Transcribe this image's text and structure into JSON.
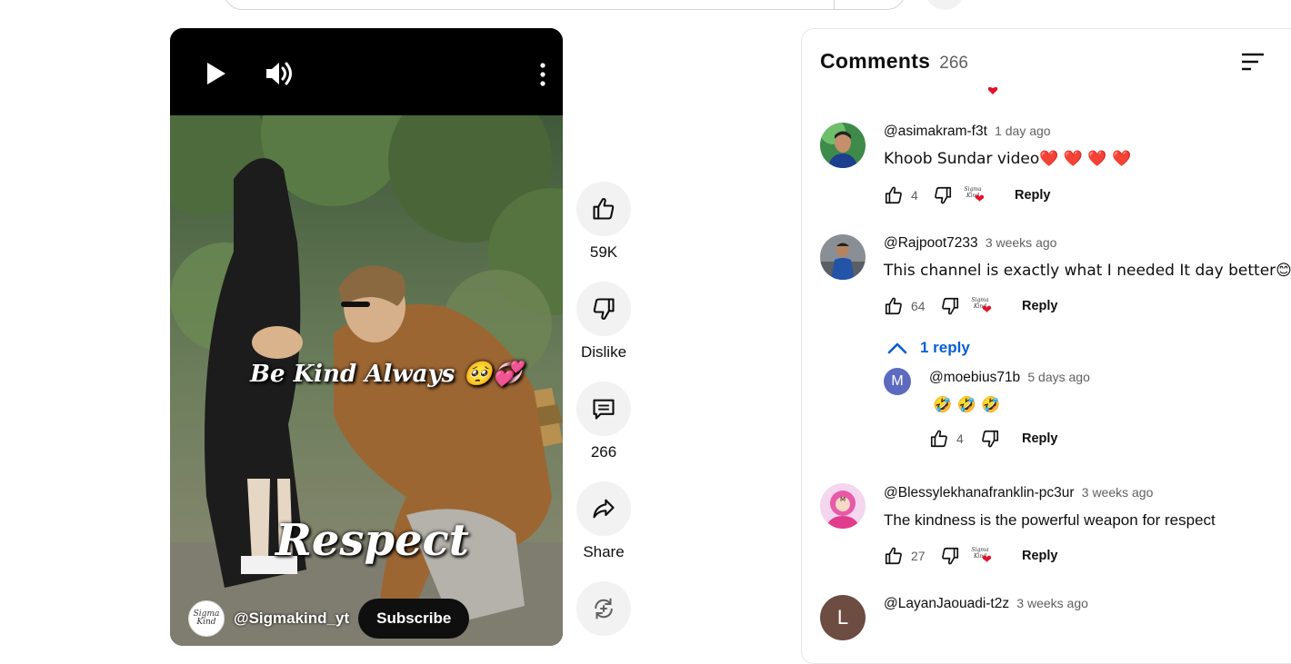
{
  "player": {
    "caption_top": "Be Kind Always 🥺💞",
    "caption_bottom": "Respect",
    "channel_handle": "@Sigmakind_yt",
    "channel_avatar_text": "Sigma Kind",
    "subscribe_label": "Subscribe",
    "icons": {
      "play": "play-icon",
      "volume": "volume-icon",
      "more": "more-vert-icon"
    }
  },
  "actions": {
    "like_count": "59K",
    "dislike_label": "Dislike",
    "comment_count": "266",
    "share_label": "Share"
  },
  "comments": {
    "title": "Comments",
    "count": "266",
    "reply_label": "Reply",
    "creator_badge_text": "Sigma Kind",
    "colors": {
      "accent_blue": "#065fd4",
      "heart_red": "#e3112b"
    },
    "items": [
      {
        "handle": "@asimakram-f3t",
        "time": "1 day ago",
        "text": "Khoob Sundar video❤️ ❤️ ❤️ ❤️",
        "likes": "4"
      },
      {
        "handle": "@Rajpoot7233",
        "time": "3 weeks ago",
        "text": "This channel is exactly what I needed It day better😊 ❤️ .,",
        "likes": "64",
        "replies_label": "1 reply"
      },
      {
        "handle": "@Blessylekhanafranklin-pc3ur",
        "time": "3 weeks ago",
        "text": "The kindness is the powerful weapon for respect",
        "likes": "27"
      },
      {
        "handle": "@LayanJaouadi-t2z",
        "time": "3 weeks ago",
        "avatar_letter": "L"
      }
    ],
    "reply": {
      "handle": "@moebius71b",
      "time": "5 days ago",
      "text": "🤣 🤣 🤣",
      "likes": "4",
      "avatar_letter": "M"
    }
  }
}
